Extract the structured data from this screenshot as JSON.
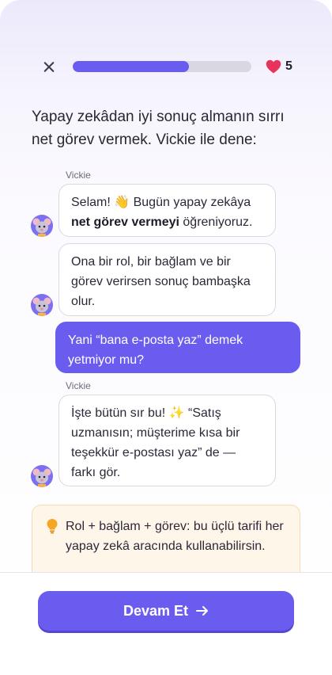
{
  "header": {
    "progress": 0.65,
    "lives": "5",
    "close_icon": "close-icon",
    "heart_icon": "heart-icon",
    "heart_color": "#e8335a"
  },
  "prompt": "Yapay zekâdan iyi sonuç almanın sırrı net görev vermek. Vickie ile dene:",
  "chat": {
    "sender_1": "Vickie",
    "msg_1_part1": "Selam! 👋 Bugün yapay zekâya",
    "msg_1_bold": "net görev vermeyi",
    "msg_1_part2": "öğreniyoruz.",
    "msg_2": "Ona bir rol, bir bağlam ve bir görev verirsen sonuç bambaşka olur.",
    "user_msg": "Yani “bana e-posta yaz” demek yetmiyor mu?",
    "sender_2": "Vickie",
    "msg_3": "İşte bütün sır bu! ✨ “Satış uzmanısın; müşterime kısa bir teşekkür e-postası yaz” de — farkı gör."
  },
  "tip": {
    "icon": "lightbulb-icon",
    "text": "Rol + bağlam + görev: bu üçlü tarifi her yapay zekâ aracında kullanabilirsin."
  },
  "cta": {
    "label": "Devam Et",
    "icon": "arrow-right-icon"
  },
  "colors": {
    "accent": "#6b5cf0",
    "tip_background": "#fff6ea",
    "tip_border": "#f6dcb5"
  }
}
